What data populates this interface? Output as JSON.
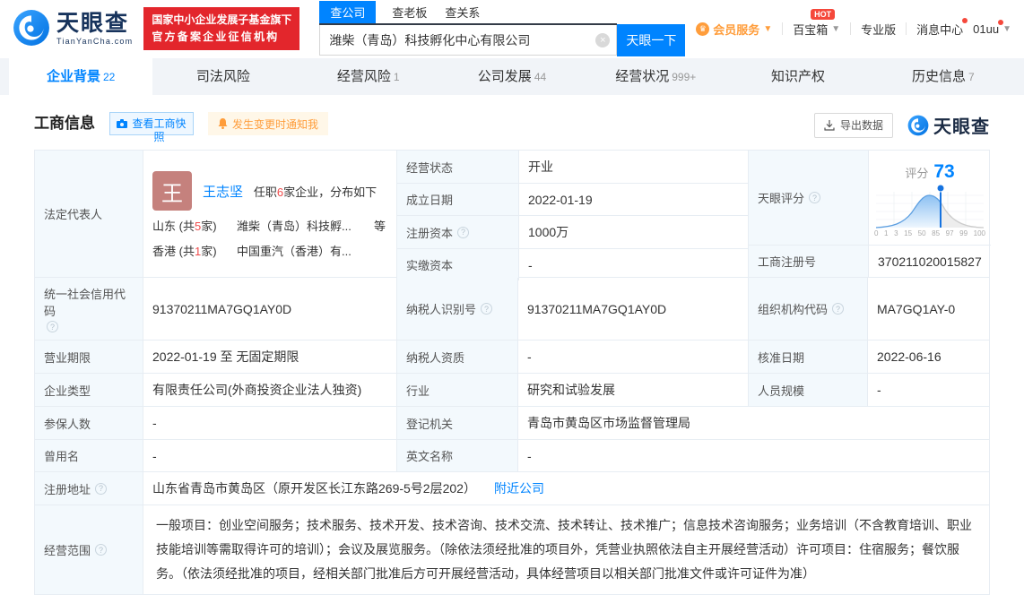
{
  "colors": {
    "accent": "#0084ff",
    "brand_red": "#e3262c",
    "orange": "#ff9d3b",
    "score_blue": "#1673e0"
  },
  "header": {
    "logo_title": "天眼查",
    "logo_sub": "TianYanCha.com",
    "badge_line1": "国家中小企业发展子基金旗下",
    "badge_line2": "官方备案企业征信机构",
    "search": {
      "tab_company": "查公司",
      "tab_boss": "查老板",
      "tab_relation": "查关系",
      "value": "潍柴（青岛）科技孵化中心有限公司",
      "clear": "×",
      "button": "天眼一下"
    },
    "menu": {
      "vip": "会员服务",
      "toolbox": "百宝箱",
      "hot": "HOT",
      "pro": "专业版",
      "messages": "消息中心",
      "user": "01uu"
    }
  },
  "nav": {
    "tabs": [
      {
        "label": "企业背景",
        "count": "22"
      },
      {
        "label": "司法风险",
        "count": ""
      },
      {
        "label": "经营风险",
        "count": "1"
      },
      {
        "label": "公司发展",
        "count": "44"
      },
      {
        "label": "经营状况",
        "count": "999+"
      },
      {
        "label": "知识产权",
        "count": ""
      },
      {
        "label": "历史信息",
        "count": "7"
      }
    ]
  },
  "section": {
    "title": "工商信息",
    "snapshot_button": "查看工商快照",
    "notify_button": "发生变更时通知我",
    "export_button": "导出数据",
    "watermark": "天眼查"
  },
  "legal_rep": {
    "label": "法定代表人",
    "avatar_char": "王",
    "name": "王志坚",
    "tenure_pre": "任职",
    "tenure_num": "6",
    "tenure_post": "家企业，分布如下",
    "dist": [
      {
        "region_pre": "山东 (共",
        "num": "5",
        "region_post": "家)",
        "company": "潍柴（青岛）科技孵...",
        "tail": "等"
      },
      {
        "region_pre": "香港 (共",
        "num": "1",
        "region_post": "家)",
        "company": "中国重汽（香港）有...",
        "tail": ""
      }
    ]
  },
  "score": {
    "label": "天眼评分",
    "caption": "评分",
    "value": "73",
    "axis": [
      "0",
      "1",
      "3",
      "15",
      "50",
      "85",
      "97",
      "99",
      "100"
    ]
  },
  "fields": {
    "status_label": "经营状态",
    "status_value": "开业",
    "established_label": "成立日期",
    "established_value": "2022-01-19",
    "reg_capital_label": "注册资本",
    "reg_capital_value": "1000万",
    "paid_capital_label": "实缴资本",
    "paid_capital_value": "-",
    "reg_number_label": "工商注册号",
    "reg_number_value": "370211020015827",
    "credit_code_label": "统一社会信用代码",
    "credit_code_value": "91370211MA7GQ1AY0D",
    "taxpayer_id_label": "纳税人识别号",
    "taxpayer_id_value": "91370211MA7GQ1AY0D",
    "org_code_label": "组织机构代码",
    "org_code_value": "MA7GQ1AY-0",
    "term_label": "营业期限",
    "term_value": "2022-01-19 至 无固定期限",
    "taxpayer_quality_label": "纳税人资质",
    "taxpayer_quality_value": "-",
    "approval_date_label": "核准日期",
    "approval_date_value": "2022-06-16",
    "company_type_label": "企业类型",
    "company_type_value": "有限责任公司(外商投资企业法人独资)",
    "industry_label": "行业",
    "industry_value": "研究和试验发展",
    "staff_size_label": "人员规模",
    "staff_size_value": "-",
    "insured_label": "参保人数",
    "insured_value": "-",
    "registry_label": "登记机关",
    "registry_value": "青岛市黄岛区市场监督管理局",
    "former_name_label": "曾用名",
    "former_name_value": "-",
    "english_name_label": "英文名称",
    "english_name_value": "-",
    "address_label": "注册地址",
    "address_value": "山东省青岛市黄岛区（原开发区长江东路269-5号2层202）",
    "address_link": "附近公司",
    "scope_label": "经营范围",
    "scope_value": "一般项目：创业空间服务；技术服务、技术开发、技术咨询、技术交流、技术转让、技术推广；信息技术咨询服务；业务培训（不含教育培训、职业技能培训等需取得许可的培训）；会议及展览服务。（除依法须经批准的项目外，凭营业执照依法自主开展经营活动）许可项目：住宿服务；餐饮服务。（依法须经批准的项目，经相关部门批准后方可开展经营活动，具体经营项目以相关部门批准文件或许可证件为准）"
  }
}
